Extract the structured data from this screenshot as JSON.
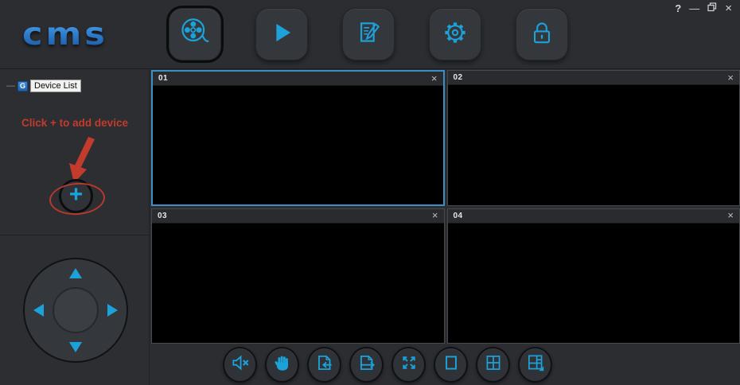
{
  "header": {
    "logo": "cms",
    "nav_buttons": [
      {
        "name": "live-view",
        "icon": "film-reel-icon",
        "selected": true
      },
      {
        "name": "playback",
        "icon": "play-icon",
        "selected": false
      },
      {
        "name": "log",
        "icon": "edit-note-icon",
        "selected": false
      },
      {
        "name": "settings",
        "icon": "gear-icon",
        "selected": false
      },
      {
        "name": "lock",
        "icon": "lock-icon",
        "selected": false
      }
    ],
    "window_controls": {
      "help_glyph": "?",
      "minimize_glyph": "—",
      "restore_icon": "restore-window-icon",
      "close_glyph": "×"
    }
  },
  "sidebar": {
    "device_tree": {
      "expander_glyph": "—",
      "icon_letter": "G",
      "label": "Device List"
    },
    "annotation_text": "Click + to add device",
    "add_glyph": "+",
    "ptz_arrows": [
      "up",
      "down",
      "left",
      "right"
    ]
  },
  "grid": {
    "close_glyph": "×",
    "panels": [
      {
        "id": "01",
        "selected": true
      },
      {
        "id": "02",
        "selected": false
      },
      {
        "id": "03",
        "selected": false
      },
      {
        "id": "04",
        "selected": false
      }
    ]
  },
  "toolbar": {
    "buttons": [
      {
        "name": "mute",
        "icon": "speaker-mute-icon"
      },
      {
        "name": "pan",
        "icon": "hand-icon"
      },
      {
        "name": "prev-page",
        "icon": "page-arrow-left-icon"
      },
      {
        "name": "next-page",
        "icon": "page-arrow-right-icon"
      },
      {
        "name": "fullscreen",
        "icon": "expand-arrows-icon"
      },
      {
        "name": "single-view",
        "icon": "single-square-icon"
      },
      {
        "name": "quad-view",
        "icon": "grid-2x2-icon"
      },
      {
        "name": "multi-view",
        "icon": "layout-grid-icon"
      }
    ]
  },
  "colors": {
    "accent": "#1ca1d8",
    "annotation_red": "#c23b2d",
    "selected_border": "#3a90c6",
    "logo_blue_top": "#5fb0ee",
    "logo_blue_bottom": "#174f97"
  }
}
